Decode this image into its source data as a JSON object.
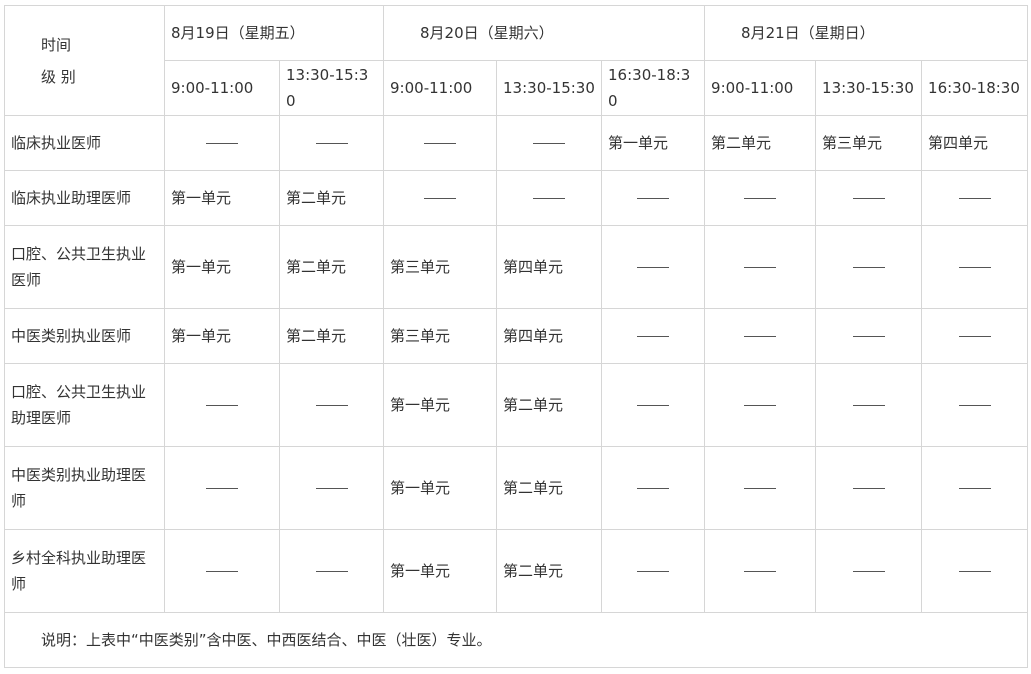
{
  "header": {
    "corner_line1": "时间",
    "corner_line2": "级 别",
    "dates": [
      {
        "label": "8月19日（星期五）",
        "span": 2
      },
      {
        "label": "8月20日（星期六）",
        "span": 3
      },
      {
        "label": "8月21日（星期日）",
        "span": 3
      }
    ],
    "times": [
      "9:00-11:00",
      "13:30-15:30",
      "9:00-11:00",
      "13:30-15:30",
      "16:30-18:30",
      "9:00-11:00",
      "13:30-15:30",
      "16:30-18:30"
    ]
  },
  "rows": [
    {
      "level": "临床执业医师",
      "cells": [
        "——",
        "——",
        "——",
        "——",
        "第一单元",
        "第二单元",
        "第三单元",
        "第四单元"
      ]
    },
    {
      "level": "临床执业助理医师",
      "cells": [
        "第一单元",
        "第二单元",
        "——",
        "——",
        "——",
        "——",
        "——",
        "——"
      ]
    },
    {
      "level": "口腔、公共卫生执业医师",
      "cells": [
        "第一单元",
        "第二单元",
        "第三单元",
        "第四单元",
        "——",
        "——",
        "——",
        "——"
      ]
    },
    {
      "level": "中医类别执业医师",
      "cells": [
        "第一单元",
        "第二单元",
        "第三单元",
        "第四单元",
        "——",
        "——",
        "——",
        "——"
      ]
    },
    {
      "level": "口腔、公共卫生执业助理医师",
      "cells": [
        "——",
        "——",
        "第一单元",
        "第二单元",
        "——",
        "——",
        "——",
        "——"
      ]
    },
    {
      "level": "中医类别执业助理医师",
      "cells": [
        "——",
        "——",
        "第一单元",
        "第二单元",
        "——",
        "——",
        "——",
        "——"
      ]
    },
    {
      "level": "乡村全科执业助理医师",
      "cells": [
        "——",
        "——",
        "第一单元",
        "第二单元",
        "——",
        "——",
        "——",
        "——"
      ]
    }
  ],
  "note": "说明：上表中“中医类别”含中医、中西医结合、中医（壮医）专业。"
}
